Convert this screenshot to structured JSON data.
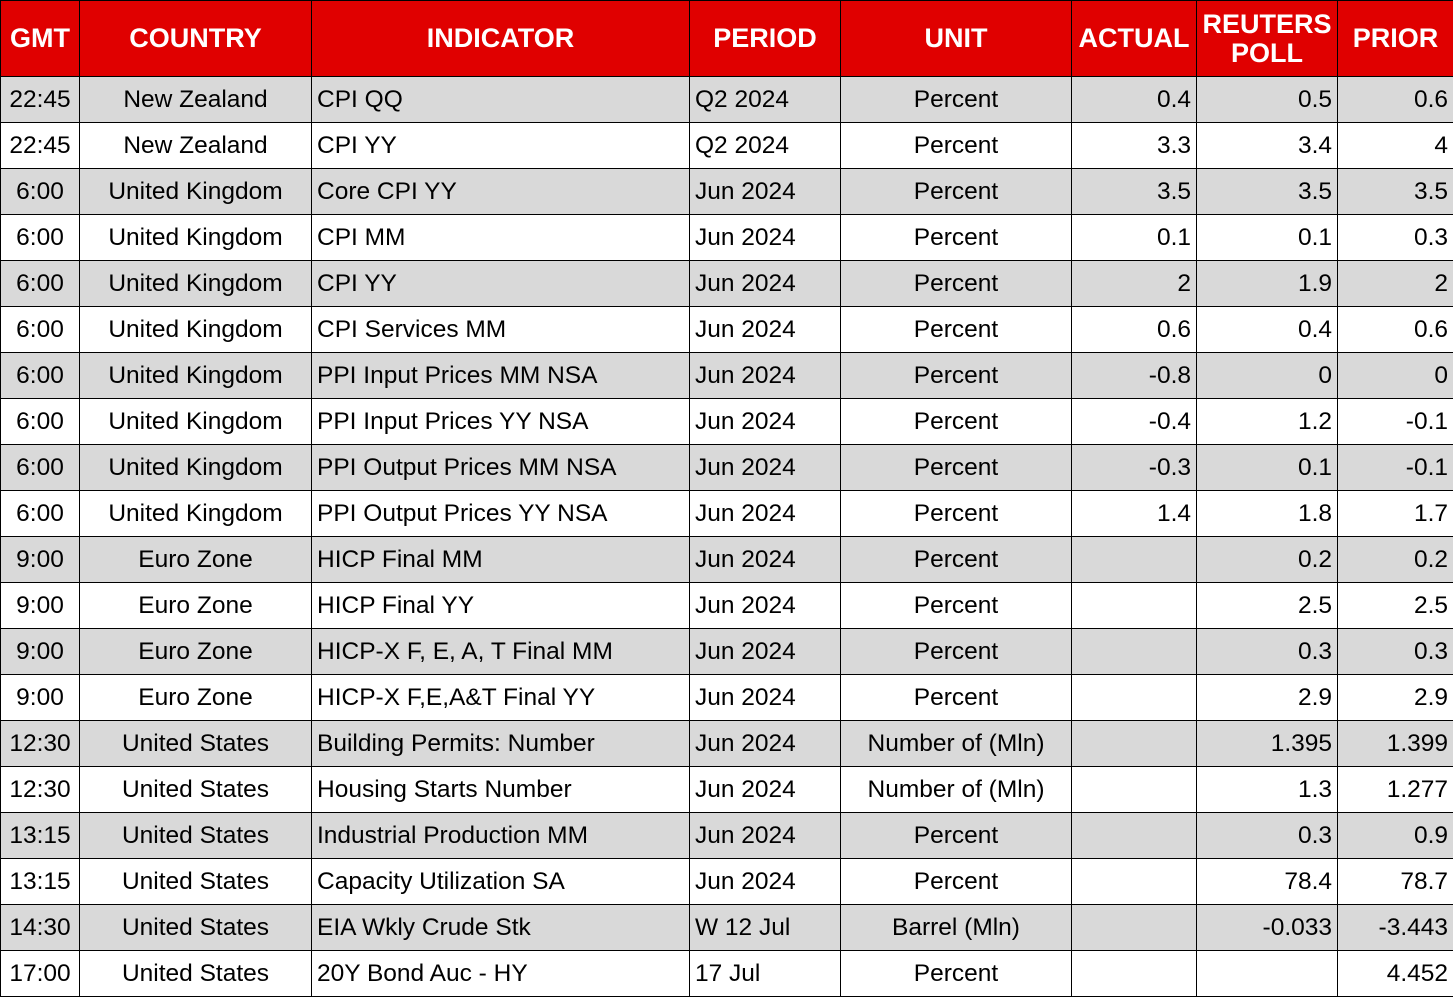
{
  "colors": {
    "header_bg": "#e00000",
    "header_text": "#ffffff",
    "row_alt": "#d9d9d9",
    "row": "#ffffff"
  },
  "columns": [
    "GMT",
    "COUNTRY",
    "INDICATOR",
    "PERIOD",
    "UNIT",
    "ACTUAL",
    "REUTERS POLL",
    "PRIOR"
  ],
  "rows": [
    [
      "22:45",
      "New Zealand",
      "CPI QQ",
      "Q2 2024",
      "Percent",
      "0.4",
      "0.5",
      "0.6"
    ],
    [
      "22:45",
      "New Zealand",
      "CPI YY",
      "Q2 2024",
      "Percent",
      "3.3",
      "3.4",
      "4"
    ],
    [
      "6:00",
      "United Kingdom",
      "Core CPI YY",
      "Jun 2024",
      "Percent",
      "3.5",
      "3.5",
      "3.5"
    ],
    [
      "6:00",
      "United Kingdom",
      "CPI MM",
      "Jun 2024",
      "Percent",
      "0.1",
      "0.1",
      "0.3"
    ],
    [
      "6:00",
      "United Kingdom",
      "CPI YY",
      "Jun 2024",
      "Percent",
      "2",
      "1.9",
      "2"
    ],
    [
      "6:00",
      "United Kingdom",
      "CPI Services MM",
      "Jun 2024",
      "Percent",
      "0.6",
      "0.4",
      "0.6"
    ],
    [
      "6:00",
      "United Kingdom",
      "PPI Input Prices MM NSA",
      "Jun 2024",
      "Percent",
      "-0.8",
      "0",
      "0"
    ],
    [
      "6:00",
      "United Kingdom",
      "PPI Input Prices YY NSA",
      "Jun 2024",
      "Percent",
      "-0.4",
      "1.2",
      "-0.1"
    ],
    [
      "6:00",
      "United Kingdom",
      "PPI Output Prices MM NSA",
      "Jun 2024",
      "Percent",
      "-0.3",
      "0.1",
      "-0.1"
    ],
    [
      "6:00",
      "United Kingdom",
      "PPI Output Prices YY NSA",
      "Jun 2024",
      "Percent",
      "1.4",
      "1.8",
      "1.7"
    ],
    [
      "9:00",
      "Euro Zone",
      "HICP Final MM",
      "Jun 2024",
      "Percent",
      "",
      "0.2",
      "0.2"
    ],
    [
      "9:00",
      "Euro Zone",
      "HICP Final YY",
      "Jun 2024",
      "Percent",
      "",
      "2.5",
      "2.5"
    ],
    [
      "9:00",
      "Euro Zone",
      "HICP-X F, E, A, T Final MM",
      "Jun 2024",
      "Percent",
      "",
      "0.3",
      "0.3"
    ],
    [
      "9:00",
      "Euro Zone",
      "HICP-X F,E,A&T Final YY",
      "Jun 2024",
      "Percent",
      "",
      "2.9",
      "2.9"
    ],
    [
      "12:30",
      "United States",
      "Building Permits: Number",
      "Jun 2024",
      "Number of (Mln)",
      "",
      "1.395",
      "1.399"
    ],
    [
      "12:30",
      "United States",
      "Housing Starts Number",
      "Jun 2024",
      "Number of (Mln)",
      "",
      "1.3",
      "1.277"
    ],
    [
      "13:15",
      "United States",
      "Industrial Production MM",
      "Jun 2024",
      "Percent",
      "",
      "0.3",
      "0.9"
    ],
    [
      "13:15",
      "United States",
      "Capacity Utilization SA",
      "Jun 2024",
      "Percent",
      "",
      "78.4",
      "78.7"
    ],
    [
      "14:30",
      "United States",
      "EIA Wkly Crude Stk",
      "W 12 Jul",
      "Barrel (Mln)",
      "",
      "-0.033",
      "-3.443"
    ],
    [
      "17:00",
      "United States",
      "20Y Bond Auc - HY",
      "17 Jul",
      "Percent",
      "",
      "",
      "4.452"
    ]
  ]
}
